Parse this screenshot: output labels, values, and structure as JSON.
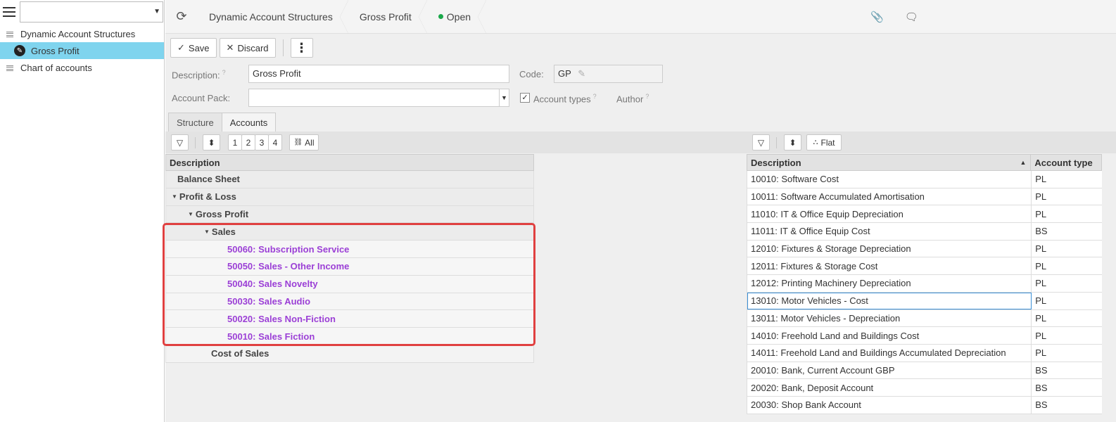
{
  "sidebar": {
    "select_value": "",
    "items": [
      {
        "label": "Dynamic Account Structures"
      },
      {
        "label": "Gross Profit"
      },
      {
        "label": "Chart of accounts"
      }
    ]
  },
  "topbar": {
    "crumbs": [
      "Dynamic Account Structures",
      "Gross Profit",
      "Open"
    ],
    "status_color": "#1aa84a"
  },
  "toolbar": {
    "save_label": "Save",
    "discard_label": "Discard",
    "more_label": "⋮"
  },
  "form": {
    "description_label": "Description:",
    "description_value": "Gross Profit",
    "code_label": "Code:",
    "code_value": "GP",
    "account_pack_label": "Account Pack:",
    "account_pack_value": "",
    "account_types_label": "Account types",
    "account_types_checked": true,
    "author_label": "Author",
    "help_mark": "?"
  },
  "tabs": [
    {
      "label": "Structure"
    },
    {
      "label": "Accounts"
    }
  ],
  "left_toolbar": {
    "levels": [
      "1",
      "2",
      "3",
      "4"
    ],
    "all_label": "All"
  },
  "right_toolbar": {
    "flat_label": "Flat"
  },
  "left_grid": {
    "header": "Description",
    "rows": [
      {
        "label": "Balance Sheet"
      },
      {
        "label": "Profit & Loss"
      },
      {
        "label": "Gross Profit"
      },
      {
        "label": "Sales"
      },
      {
        "label": "50060: Subscription Service"
      },
      {
        "label": "50050: Sales - Other Income"
      },
      {
        "label": "50040: Sales Novelty"
      },
      {
        "label": "50030: Sales Audio"
      },
      {
        "label": "50020: Sales Non-Fiction"
      },
      {
        "label": "50010: Sales Fiction"
      },
      {
        "label": "Cost of Sales"
      }
    ]
  },
  "right_grid": {
    "header_description": "Description",
    "header_type": "Account type",
    "rows": [
      {
        "desc": "10010: Software Cost",
        "type": "PL"
      },
      {
        "desc": "10011: Software Accumulated Amortisation",
        "type": "PL"
      },
      {
        "desc": "11010: IT & Office Equip Depreciation",
        "type": "PL"
      },
      {
        "desc": "11011: IT & Office Equip Cost",
        "type": "BS"
      },
      {
        "desc": "12010: Fixtures & Storage Depreciation",
        "type": "PL"
      },
      {
        "desc": "12011: Fixtures & Storage Cost",
        "type": "PL"
      },
      {
        "desc": "12012: Printing Machinery Depreciation",
        "type": "PL"
      },
      {
        "desc": "13010: Motor Vehicles - Cost",
        "type": "PL"
      },
      {
        "desc": "13011: Motor Vehicles - Depreciation",
        "type": "PL"
      },
      {
        "desc": "14010: Freehold Land and Buildings Cost",
        "type": "PL"
      },
      {
        "desc": "14011: Freehold Land and Buildings Accumulated Depreciation",
        "type": "PL"
      },
      {
        "desc": "20010: Bank, Current Account GBP",
        "type": "BS"
      },
      {
        "desc": "20020: Bank, Deposit Account",
        "type": "BS"
      },
      {
        "desc": "20030: Shop Bank Account",
        "type": "BS"
      }
    ]
  },
  "colors": {
    "leaf_text": "#9b3fd6",
    "highlight_border": "#e04040",
    "sidebar_active": "#7fd4ee"
  }
}
